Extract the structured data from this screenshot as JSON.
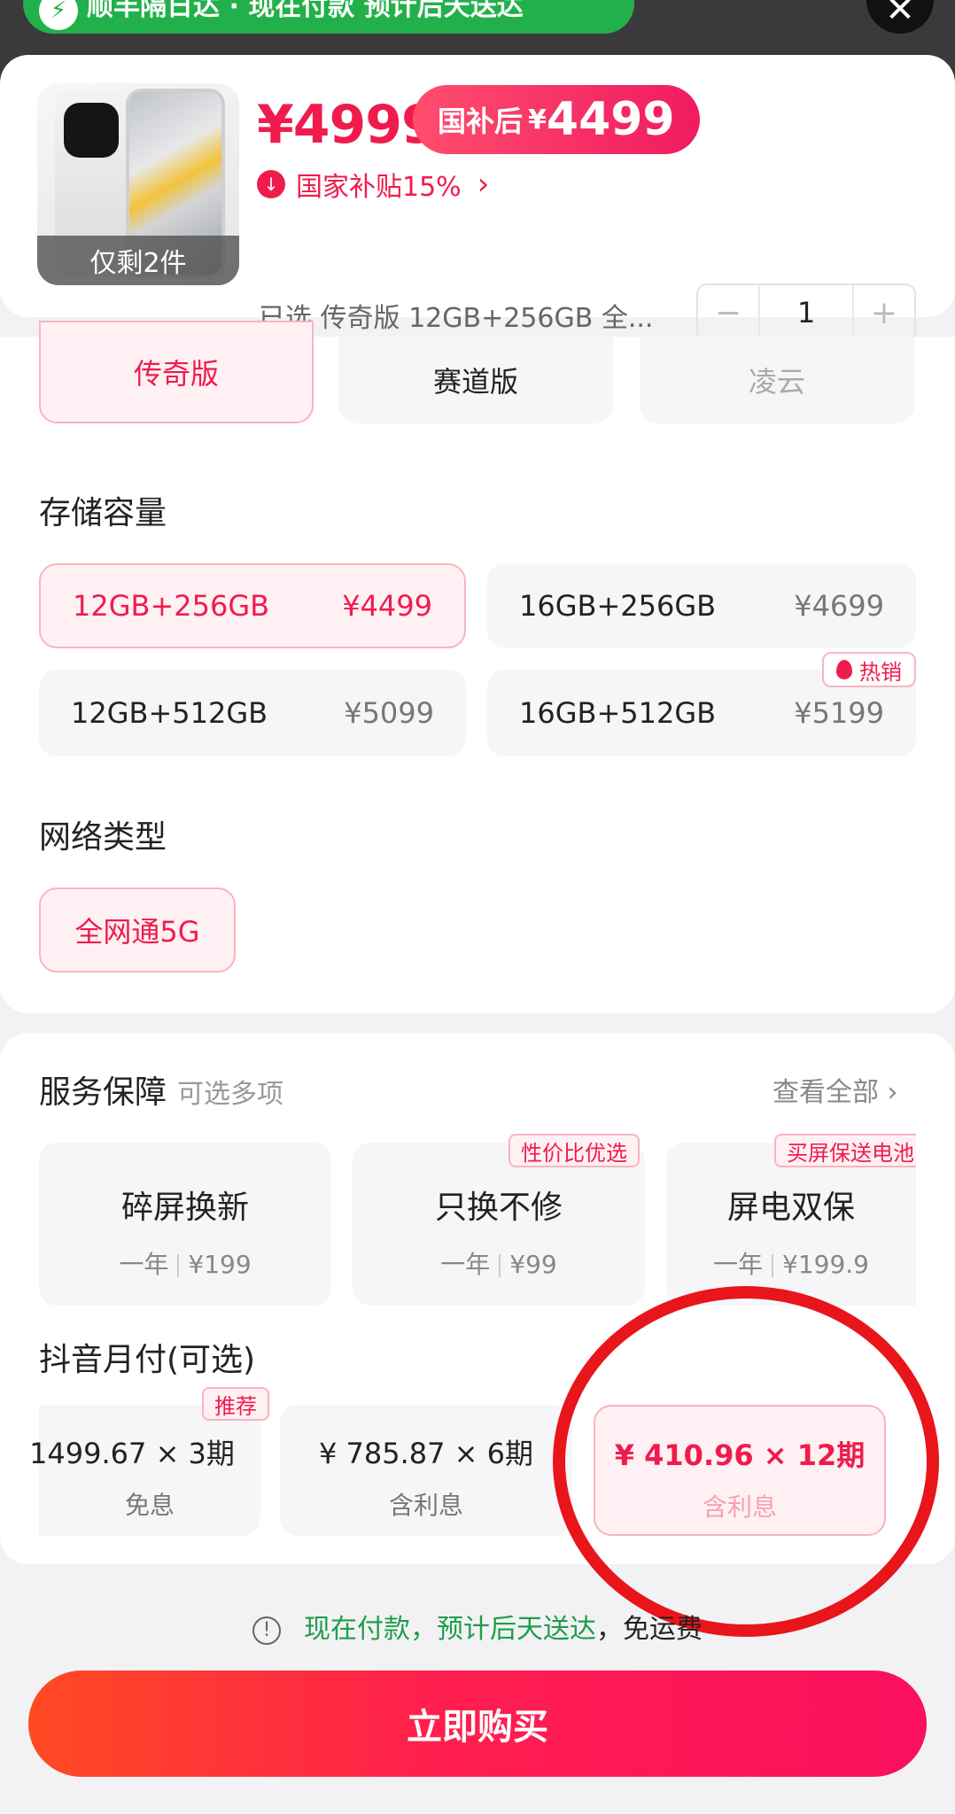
{
  "top_notice": {
    "text": "顺丰隔日达 · 现在付款 预计后天送达"
  },
  "product": {
    "price_label": "¥4999",
    "subsidy_badge": {
      "prefix": "国补后",
      "currency": "¥",
      "amount": "4499"
    },
    "subsidy_text": "国家补贴15%",
    "stock_label": "仅剩2件",
    "selected_text": "已选 传奇版 12GB+256GB 全...",
    "quantity": "1",
    "minus": "−",
    "plus": "+"
  },
  "editions": [
    "传奇版",
    "赛道版",
    "凌云"
  ],
  "storage": {
    "title": "存储容量",
    "options": [
      {
        "name": "12GB+256GB",
        "price": "¥4499"
      },
      {
        "name": "16GB+256GB",
        "price": "¥4699"
      },
      {
        "name": "12GB+512GB",
        "price": "¥5099"
      },
      {
        "name": "16GB+512GB",
        "price": "¥5199"
      }
    ],
    "hot_badge": "热销"
  },
  "network": {
    "title": "网络类型",
    "option": "全网通5G"
  },
  "services": {
    "title": "服务保障",
    "hint": "可选多项",
    "view_all": "查看全部",
    "items": [
      {
        "name": "碎屏换新",
        "term": "一年",
        "price": "¥199"
      },
      {
        "name": "只换不修",
        "term": "一年",
        "price": "¥99",
        "tag": "性价比优选"
      },
      {
        "name": "屏电双保",
        "term": "一年",
        "price": "¥199.9",
        "tag": "买屏保送电池"
      }
    ]
  },
  "installments": {
    "title": "抖音月付(可选)",
    "recommend_tag": "推荐",
    "items": [
      {
        "amount": "1499.67 × 3期",
        "note": "免息"
      },
      {
        "amount": "¥ 785.87 × 6期",
        "note": "含利息"
      },
      {
        "amount": "¥ 410.96 × 12期",
        "note": "含利息"
      }
    ]
  },
  "delivery_notice": {
    "green": "现在付款，预计后天送达",
    "rest": "，免运费"
  },
  "buy_button": "立即购买",
  "colors": {
    "accent": "#f01b4d",
    "green": "#22b04a",
    "highlight_circle": "#e8151b"
  }
}
